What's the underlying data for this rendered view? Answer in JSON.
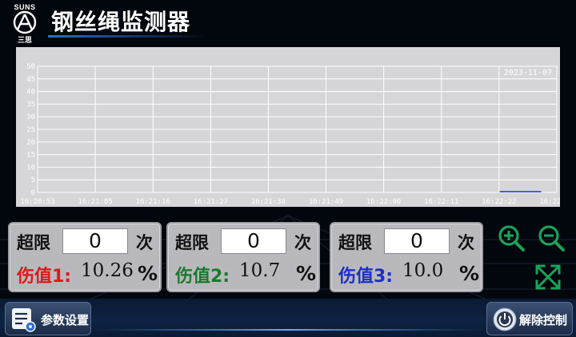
{
  "header": {
    "logo_top": "SUNS",
    "logo_bottom": "三思",
    "title": "钢丝绳监测器"
  },
  "chart_data": {
    "type": "line",
    "y_ticks": [
      "50",
      "45",
      "40",
      "35",
      "30",
      "25",
      "20",
      "15",
      "10",
      "5",
      "0"
    ],
    "x_ticks": [
      "16:20:53",
      "16:21:05",
      "16:21:16",
      "16:21:27",
      "16:21:38",
      "16:21:49",
      "16:22:00",
      "16:22:11",
      "16:22:22",
      "16:22:33"
    ],
    "ylim": [
      0,
      50
    ],
    "date": "2023-11-07",
    "grid": true,
    "series": [
      {
        "color": "#1c2fd1",
        "x_start": "16:22:22",
        "x_end": "16:22:30",
        "value": 0
      }
    ]
  },
  "cards": [
    {
      "over_label": "超限",
      "count": "0",
      "times_label": "次",
      "damage_label": "伤值1:",
      "damage_color": "#e01818",
      "damage_value": "10.26",
      "unit": "%"
    },
    {
      "over_label": "超限",
      "count": "0",
      "times_label": "次",
      "damage_label": "伤值2:",
      "damage_color": "#1b7a2e",
      "damage_value": "10.7",
      "unit": "%"
    },
    {
      "over_label": "超限",
      "count": "0",
      "times_label": "次",
      "damage_label": "伤值3:",
      "damage_color": "#1c2fc8",
      "damage_value": "10.0",
      "unit": "%"
    }
  ],
  "toolbar": {
    "zoom_in_icon": "zoom-in-icon",
    "zoom_out_icon": "zoom-out-icon",
    "fit_icon": "expand-icon",
    "icon_color": "#19a35a"
  },
  "bottom": {
    "params_label": "参数设置",
    "release_label": "解除控制"
  }
}
